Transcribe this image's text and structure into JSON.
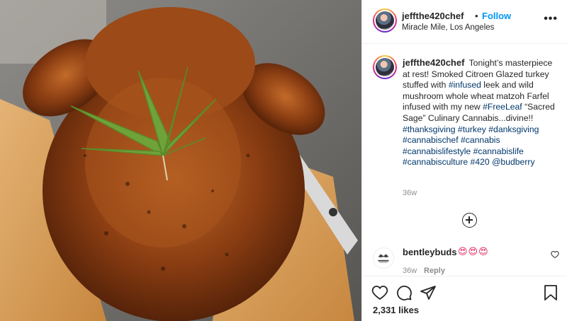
{
  "post": {
    "username": "jeffthe420chef",
    "dot": "•",
    "follow_label": "Follow",
    "location": "Miracle Mile, Los Angeles",
    "more_label": "•••",
    "caption_parts": [
      {
        "text": "Tonight’s masterpiece at rest! Smoked Citroen Glazed turkey stuffed with ",
        "link": false
      },
      {
        "text": "#infused",
        "link": true
      },
      {
        "text": " leek and wild mushroom whole wheat matzoh Farfel infused with my new ",
        "link": false
      },
      {
        "text": "#FreeLeaf",
        "link": true
      },
      {
        "text": " “Sacred Sage” Culinary Cannabis...divine!! ",
        "link": false
      },
      {
        "text": "#thanksgiving",
        "link": true
      },
      {
        "text": " ",
        "link": false
      },
      {
        "text": "#turkey",
        "link": true
      },
      {
        "text": " ",
        "link": false
      },
      {
        "text": "#danksgiving",
        "link": true
      },
      {
        "text": " ",
        "link": false
      },
      {
        "text": "#cannabischef",
        "link": true
      },
      {
        "text": " ",
        "link": false
      },
      {
        "text": "#cannabis",
        "link": true
      },
      {
        "text": " ",
        "link": false
      },
      {
        "text": "#cannabislifestyle",
        "link": true
      },
      {
        "text": " ",
        "link": false
      },
      {
        "text": "#cannabislife",
        "link": true
      },
      {
        "text": " ",
        "link": false
      },
      {
        "text": "#cannabisculture",
        "link": true
      },
      {
        "text": " ",
        "link": false
      },
      {
        "text": "#420",
        "link": true
      },
      {
        "text": " ",
        "link": false
      },
      {
        "text": "@budberry",
        "link": true
      }
    ],
    "caption_time": "36w",
    "likes": "2,331 likes"
  },
  "comment": {
    "username": "bentleybuds",
    "emojis": "😍😍😍",
    "time": "36w",
    "reply_label": "Reply"
  },
  "icons": [
    "more-icon",
    "load-more-icon",
    "heart-icon",
    "like-icon",
    "comment-icon",
    "share-icon",
    "save-icon"
  ],
  "colors": {
    "link": "#00376b",
    "follow": "#0095f6",
    "muted": "#8e8e8e",
    "text": "#262626"
  }
}
